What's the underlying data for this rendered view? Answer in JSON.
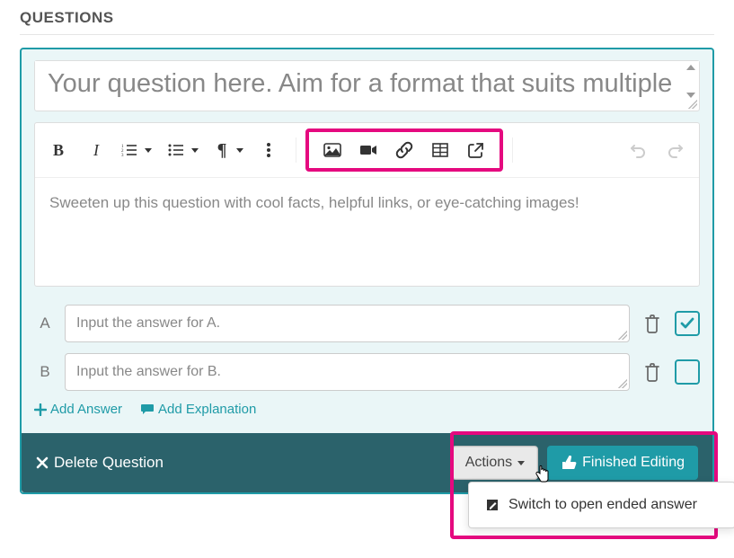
{
  "heading": "QUESTIONS",
  "question": {
    "placeholder": "Your question here. Aim for a format that suits multiple",
    "detailsPlaceholder": "Sweeten up this question with cool facts, helpful links, or eye-catching images!"
  },
  "answers": [
    {
      "letter": "A",
      "placeholder": "Input the answer for A.",
      "correct": true
    },
    {
      "letter": "B",
      "placeholder": "Input the answer for B.",
      "correct": false
    }
  ],
  "links": {
    "addAnswer": "Add Answer",
    "addExplanation": "Add Explanation"
  },
  "footer": {
    "delete": "Delete Question",
    "actions": "Actions",
    "finished": "Finished Editing"
  },
  "menu": {
    "switch": "Switch to open ended answer"
  }
}
